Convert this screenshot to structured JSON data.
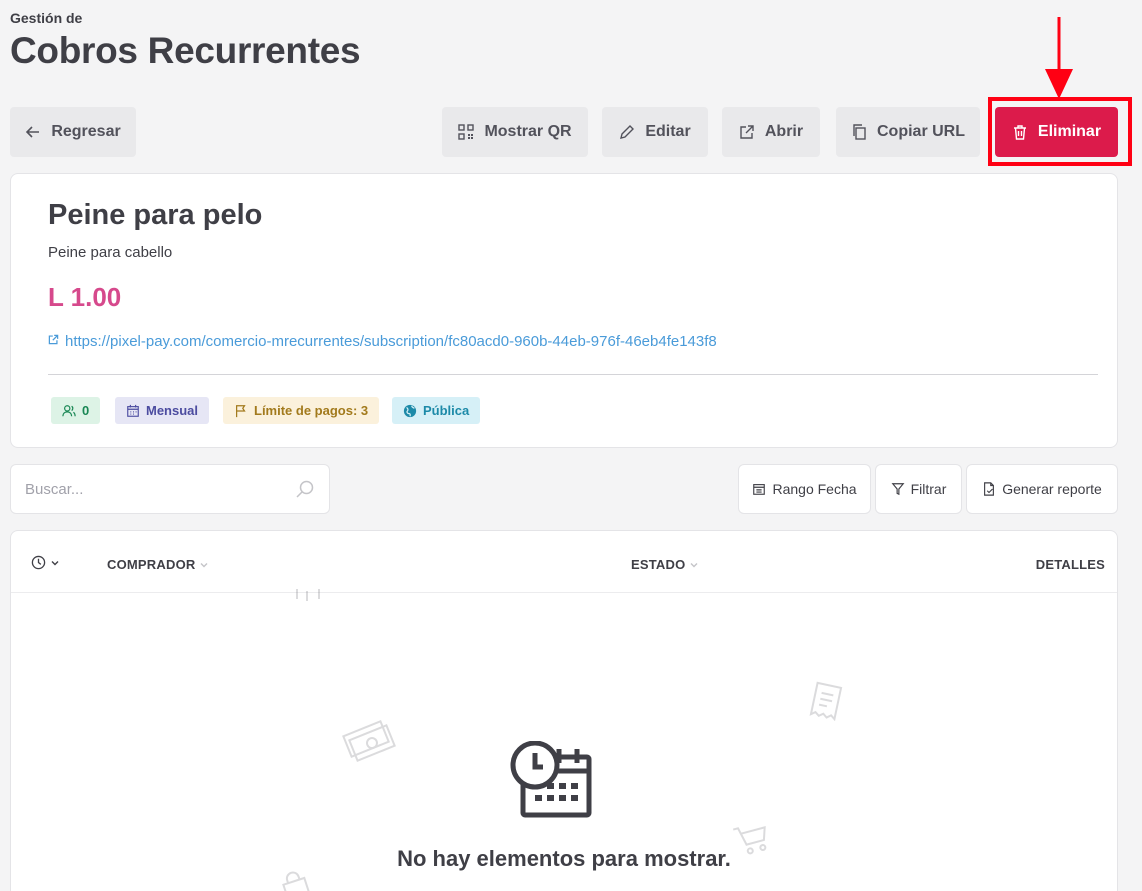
{
  "header": {
    "kicker": "Gestión de",
    "title": "Cobros Recurrentes"
  },
  "toolbar": {
    "back_label": "Regresar",
    "qr_label": "Mostrar QR",
    "edit_label": "Editar",
    "open_label": "Abrir",
    "copy_label": "Copiar URL",
    "delete_label": "Eliminar"
  },
  "product": {
    "name": "Peine para pelo",
    "description": "Peine para cabello",
    "price": "L 1.00",
    "url": "https://pixel-pay.com/comercio-mrecurrentes/subscription/fc80acd0-960b-44eb-976f-46eb4fe143f8",
    "badges": {
      "subscribers": "0",
      "frequency": "Mensual",
      "payment_limit": "Límite de pagos: 3",
      "visibility": "Pública"
    }
  },
  "search": {
    "placeholder": "Buscar...",
    "value": ""
  },
  "table_toolbar": {
    "date_range_label": "Rango Fecha",
    "filter_label": "Filtrar",
    "report_label": "Generar reporte"
  },
  "table": {
    "columns": {
      "buyer": "COMPRADOR",
      "status": "ESTADO",
      "details": "DETALLES"
    },
    "empty_message": "No hay elementos para mostrar."
  },
  "colors": {
    "danger": "#dc1b4b",
    "price": "#d6498c",
    "link": "#4a9bd9",
    "annotation": "#ff0013"
  }
}
